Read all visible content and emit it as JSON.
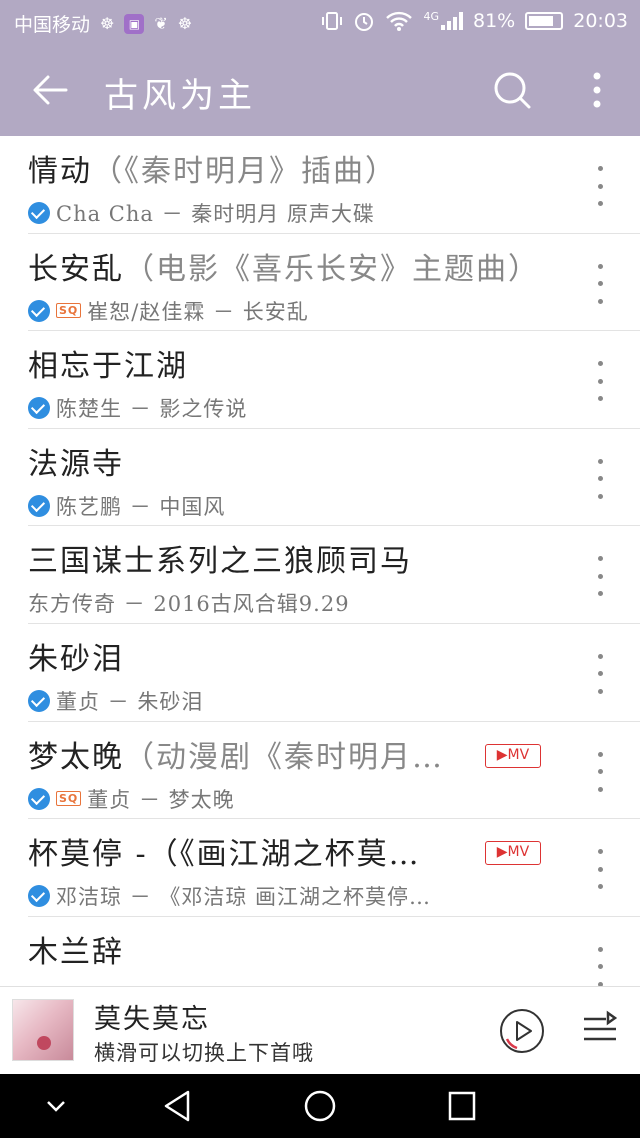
{
  "status_bar": {
    "carrier": "中国移动",
    "network": "4G",
    "battery": "81%",
    "battery_level": 0.81,
    "time": "20:03",
    "icons": [
      "notification-icon",
      "app-icon",
      "notification-icon",
      "notification-icon",
      "vibrate-icon",
      "alarm-icon",
      "wifi-icon",
      "signal-icon",
      "battery-icon"
    ]
  },
  "header": {
    "title": "古风为主",
    "icons": [
      "back-arrow-icon",
      "search-icon",
      "more-vertical-icon"
    ]
  },
  "songs": [
    {
      "title": "情动",
      "subtitle": "（《秦时明月》插曲）",
      "verified": true,
      "sq": false,
      "mv": false,
      "meta": "Cha Cha － 秦时明月 原声大碟"
    },
    {
      "title": "长安乱",
      "subtitle": "（电影《喜乐长安》主题曲）",
      "verified": true,
      "sq": true,
      "mv": false,
      "meta": "崔恕/赵佳霖 － 长安乱"
    },
    {
      "title": "相忘于江湖",
      "subtitle": "",
      "verified": true,
      "sq": false,
      "mv": false,
      "meta": "陈楚生 － 影之传说"
    },
    {
      "title": "法源寺",
      "subtitle": "",
      "verified": true,
      "sq": false,
      "mv": false,
      "meta": "陈艺鹏 － 中国风"
    },
    {
      "title": "三国谋士系列之三狼顾司马",
      "subtitle": "",
      "verified": false,
      "sq": false,
      "mv": false,
      "meta": "东方传奇 － 2016古风合辑9.29"
    },
    {
      "title": "朱砂泪",
      "subtitle": "",
      "verified": true,
      "sq": false,
      "mv": false,
      "meta": "董贞 － 朱砂泪"
    },
    {
      "title": "梦太晚",
      "subtitle": "（动漫剧《秦时明月…",
      "verified": true,
      "sq": true,
      "mv": true,
      "meta": "董贞 － 梦太晚"
    },
    {
      "title": "杯莫停 -（《画江湖之杯莫…",
      "subtitle": "",
      "verified": true,
      "sq": false,
      "mv": true,
      "meta": "邓洁琼 － 《邓洁琼  画江湖之杯莫停…"
    },
    {
      "title": "木兰辞",
      "subtitle": "",
      "verified": false,
      "sq": false,
      "mv": false,
      "meta": ""
    }
  ],
  "badges": {
    "sq": "SQ",
    "mv": "▶MV"
  },
  "mini_player": {
    "title": "莫失莫忘",
    "hint": "横滑可以切换上下首哦",
    "icons": [
      "album-cover",
      "play-icon",
      "playlist-icon"
    ]
  },
  "nav_bar": {
    "icons": [
      "collapse-icon",
      "back-triangle-icon",
      "home-circle-icon",
      "recents-square-icon"
    ]
  },
  "colors": {
    "header_bg": "#b2a9c3",
    "verified": "#2f8ee0",
    "mv": "#dd3333",
    "sq": "#e8743b",
    "play_ring": "#d9394a"
  }
}
